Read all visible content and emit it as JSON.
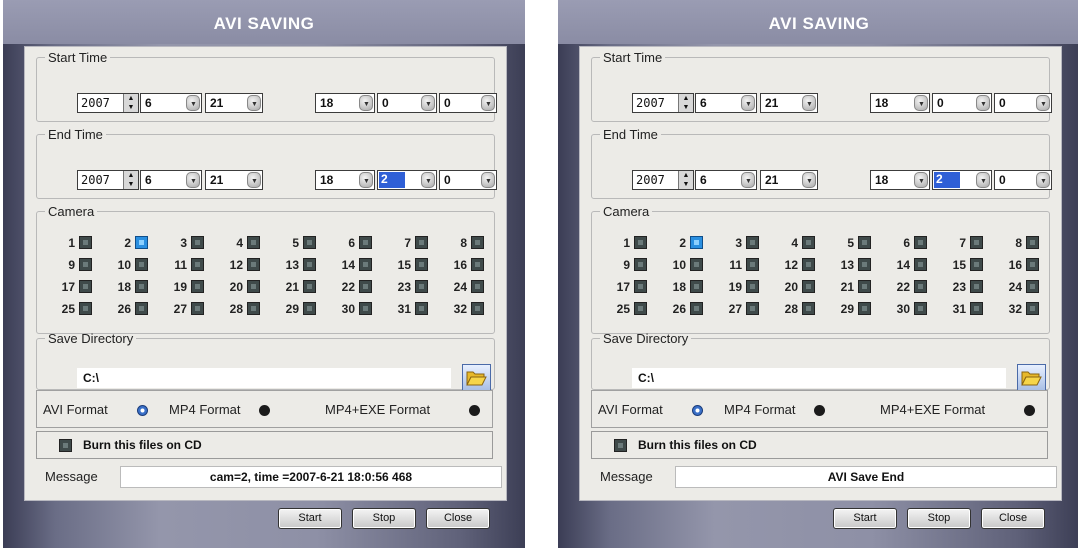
{
  "dialogs": [
    {
      "title": "AVI SAVING",
      "start_time": {
        "label": "Start Time",
        "year": "2007",
        "month": "6",
        "day": "21",
        "hour": "18",
        "minute": "0",
        "second": "0"
      },
      "end_time": {
        "label": "End Time",
        "year": "2007",
        "month": "6",
        "day": "21",
        "hour": "18",
        "minute": "2",
        "second": "0"
      },
      "camera": {
        "label": "Camera",
        "numbers": [
          "1",
          "2",
          "3",
          "4",
          "5",
          "6",
          "7",
          "8",
          "9",
          "10",
          "11",
          "12",
          "13",
          "14",
          "15",
          "16",
          "17",
          "18",
          "19",
          "20",
          "21",
          "22",
          "23",
          "24",
          "25",
          "26",
          "27",
          "28",
          "29",
          "30",
          "31",
          "32"
        ],
        "checked": [
          2
        ]
      },
      "save_directory": {
        "label": "Save Directory",
        "path": "C:\\"
      },
      "formats": {
        "avi": "AVI Format",
        "mp4": "MP4 Format",
        "mp4exe": "MP4+EXE Format",
        "selected": "avi"
      },
      "burn": {
        "label": "Burn this files on CD",
        "checked": false
      },
      "message": {
        "label": "Message",
        "text": "cam=2, time =2007-6-21 18:0:56  468"
      },
      "buttons": {
        "start": "Start",
        "stop": "Stop",
        "close": "Close"
      }
    },
    {
      "title": "AVI SAVING",
      "start_time": {
        "label": "Start Time",
        "year": "2007",
        "month": "6",
        "day": "21",
        "hour": "18",
        "minute": "0",
        "second": "0"
      },
      "end_time": {
        "label": "End Time",
        "year": "2007",
        "month": "6",
        "day": "21",
        "hour": "18",
        "minute": "2",
        "second": "0"
      },
      "camera": {
        "label": "Camera",
        "numbers": [
          "1",
          "2",
          "3",
          "4",
          "5",
          "6",
          "7",
          "8",
          "9",
          "10",
          "11",
          "12",
          "13",
          "14",
          "15",
          "16",
          "17",
          "18",
          "19",
          "20",
          "21",
          "22",
          "23",
          "24",
          "25",
          "26",
          "27",
          "28",
          "29",
          "30",
          "31",
          "32"
        ],
        "checked": [
          2
        ]
      },
      "save_directory": {
        "label": "Save Directory",
        "path": "C:\\"
      },
      "formats": {
        "avi": "AVI Format",
        "mp4": "MP4 Format",
        "mp4exe": "MP4+EXE Format",
        "selected": "avi"
      },
      "burn": {
        "label": "Burn this files on CD",
        "checked": false
      },
      "message": {
        "label": "Message",
        "text": "AVI Save End"
      },
      "buttons": {
        "start": "Start",
        "stop": "Stop",
        "close": "Close"
      }
    }
  ],
  "colors": {
    "checked_camera": "#2a8fe0",
    "dialog_frame": "#8e90a6",
    "panel": "#ecebe7"
  },
  "icons": {
    "folder": "folder-open-icon",
    "spin": "spin-arrows-icon",
    "dropdown": "chevron-down-icon"
  }
}
